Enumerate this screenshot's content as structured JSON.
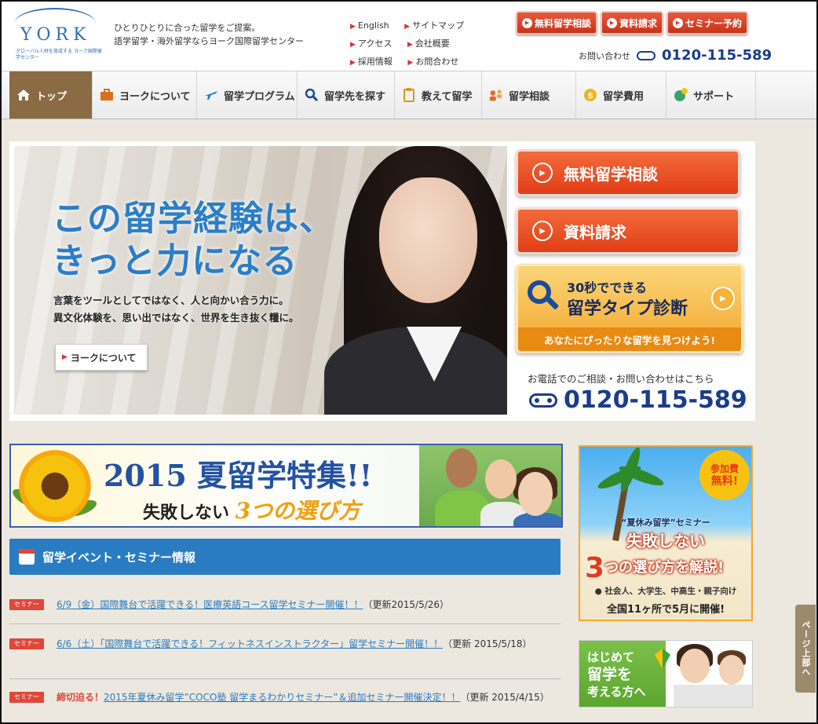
{
  "header": {
    "logo_text": "YORK",
    "logo_sub": "グローバル人材を育成する ヨーク国際留学センター",
    "tagline_1": "ひとりひとりに合った留学をご提案。",
    "tagline_2": "語学留学・海外留学ならヨーク国際留学センター",
    "links": [
      "English",
      "サイトマップ",
      "アクセス",
      "会社概要",
      "採用情報",
      "お問合わせ"
    ],
    "buttons": [
      "無料留学相談",
      "資料請求",
      "セミナー予約"
    ],
    "contact_label": "お問い合わせ",
    "phone": "0120-115-589"
  },
  "nav": {
    "items": [
      {
        "label": "トップ",
        "icon": "home-icon"
      },
      {
        "label": "ヨークについて",
        "icon": "briefcase-icon"
      },
      {
        "label": "留学プログラム",
        "icon": "airplane-icon"
      },
      {
        "label": "留学先を探す",
        "icon": "search-icon"
      },
      {
        "label": "教えて留学",
        "icon": "clipboard-icon"
      },
      {
        "label": "留学相談",
        "icon": "people-icon"
      },
      {
        "label": "留学費用",
        "icon": "coin-icon"
      },
      {
        "label": "サポート",
        "icon": "support-icon"
      }
    ]
  },
  "hero": {
    "title_1": "この留学経験は、",
    "title_2": "きっと力になる",
    "copy_1": "言葉をツールとしてではなく、人と向かい合う力に。",
    "copy_2": "異文化体験を、思い出ではなく、世界を生き抜く糧に。",
    "button": "ヨークについて",
    "cta_1": "無料留学相談",
    "cta_2": "資料請求",
    "diag_1": "30秒でできる",
    "diag_2": "留学タイプ診断",
    "diag_3": "あなたにぴったりな留学を見つけよう!",
    "phone_label": "お電話でのご相談・お問い合わせはこちら",
    "phone": "0120-115-589"
  },
  "summer": {
    "title_year": "2015",
    "title_main": "夏留学特集!!",
    "sub_1": "失敗しない",
    "sub_three": "3つの選び方"
  },
  "events": {
    "heading": "留学イベント・セミナー情報",
    "items": [
      {
        "tag": "セミナー",
        "deadline": "",
        "link": "6/9（金）国際舞台で活躍できる！医療英語コース留学セミナー開催！！",
        "updated": "（更新2015/5/26）"
      },
      {
        "tag": "セミナー",
        "deadline": "",
        "link": "6/6（土）「国際舞台で活躍できる！フィットネスインストラクター」留学セミナー開催！！",
        "updated": "（更新 2015/5/18）"
      },
      {
        "tag": "セミナー",
        "deadline": "締切迫る！",
        "link": "2015年夏休み留学”COCO塾 留学まるわかりセミナー”＆追加セミナー開催決定！！",
        "updated": "（更新 2015/4/15）"
      }
    ]
  },
  "seminar_banner": {
    "badge_1": "参加費",
    "badge_2": "無料!",
    "line_1": "“夏休み留学”セミナー",
    "line_2": "失敗しない",
    "line_3_num": "3",
    "line_3": "つの選び方を解説!",
    "line_4": "● 社会人、大学生、中高生・親子向け",
    "line_5": "全国11ヶ所で5月に開催!"
  },
  "first_banner": {
    "line_1": "はじめて",
    "line_2": "留学を",
    "line_3": "考える方へ"
  },
  "page_top": "ページ上部へ",
  "colors": {
    "accent_blue": "#2a7cc2",
    "cta_red": "#e23d17",
    "nav_active": "#8a6b43",
    "phone_navy": "#1a3c8c"
  }
}
